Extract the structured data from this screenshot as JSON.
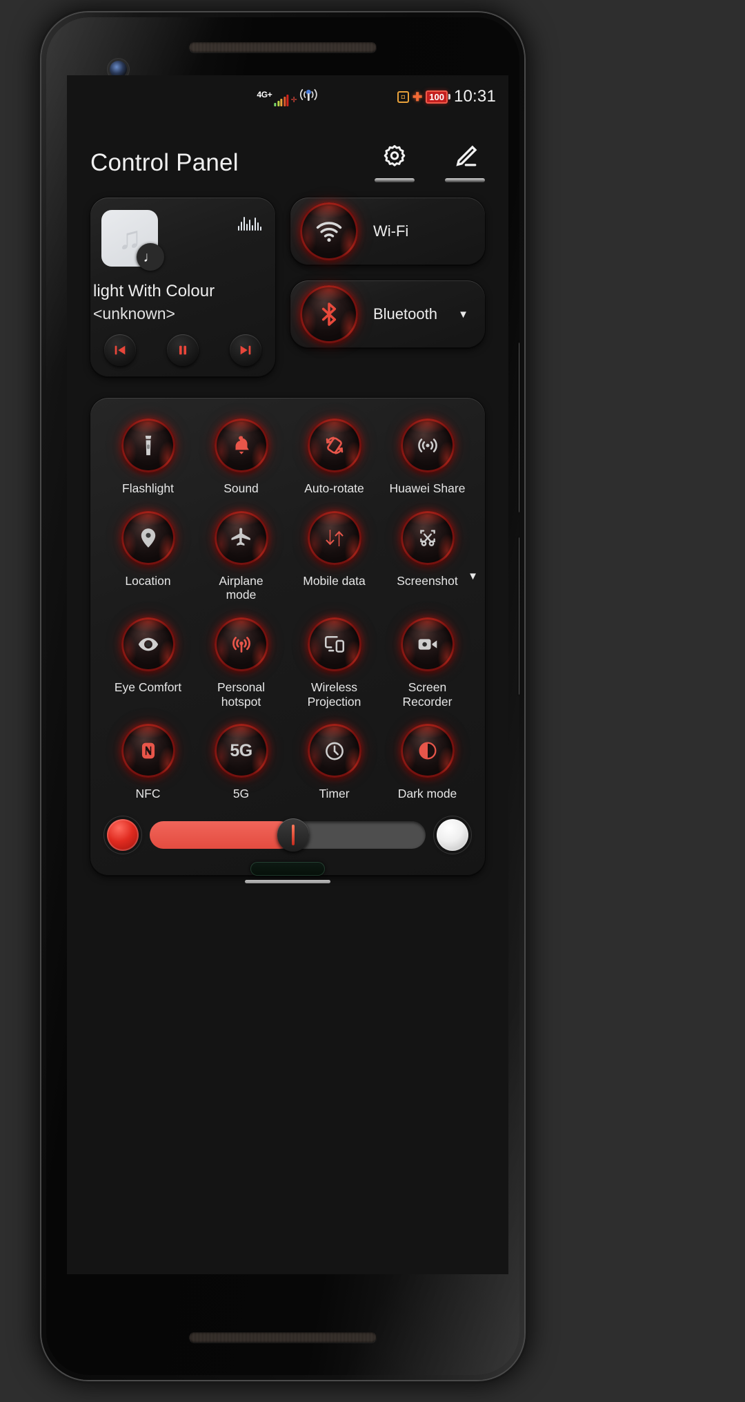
{
  "statusbar": {
    "network_label": "4G+",
    "signal_icon": "signal-bars-icon",
    "sim_cross_icon": "sim-cross-icon",
    "hotspot_icon": "hotspot-waves-icon",
    "nfc_icon": "nfc-square-icon",
    "bluetooth_icon": "bluetooth-icon",
    "battery_level": "100",
    "time": "10:31"
  },
  "header": {
    "title": "Control Panel",
    "settings_icon": "gear-icon",
    "edit_icon": "pencil-edit-icon"
  },
  "music": {
    "album_art_icon": "music-note-icon",
    "album_badge_icon": "single-note-icon",
    "equalizer_icon": "equalizer-icon",
    "title": "light With Colour",
    "artist": "<unknown>",
    "previous_icon": "skip-previous-icon",
    "play_pause_icon": "pause-icon",
    "next_icon": "skip-next-icon"
  },
  "connectivity": [
    {
      "label": "Wi-Fi",
      "icon": "wifi-icon",
      "caret": "",
      "has_caret": false
    },
    {
      "label": "Bluetooth",
      "icon": "bluetooth-icon",
      "caret": "▼",
      "has_caret": true
    }
  ],
  "tiles": [
    {
      "label": "Flashlight",
      "icon": "flashlight-icon",
      "has_caret": false
    },
    {
      "label": "Sound",
      "icon": "bell-icon",
      "has_caret": false
    },
    {
      "label": "Auto-rotate",
      "icon": "auto-rotate-icon",
      "has_caret": false
    },
    {
      "label": "Huawei Share",
      "icon": "huawei-share-icon",
      "has_caret": false
    },
    {
      "label": "Location",
      "icon": "location-pin-icon",
      "has_caret": false
    },
    {
      "label": "Airplane mode",
      "icon": "airplane-icon",
      "has_caret": false
    },
    {
      "label": "Mobile data",
      "icon": "mobile-data-arrows-icon",
      "has_caret": false
    },
    {
      "label": "Screenshot",
      "icon": "screenshot-scissors-icon",
      "has_caret": true,
      "caret": "▼"
    },
    {
      "label": "Eye Comfort",
      "icon": "eye-icon",
      "has_caret": false
    },
    {
      "label": "Personal hotspot",
      "icon": "hotspot-icon",
      "has_caret": false
    },
    {
      "label": "Wireless Projection",
      "icon": "cast-screen-icon",
      "has_caret": false
    },
    {
      "label": "Screen Recorder",
      "icon": "video-camera-icon",
      "has_caret": false
    },
    {
      "label": "NFC",
      "icon": "nfc-icon",
      "has_caret": false
    },
    {
      "label": "5G",
      "icon": "5g-text-icon",
      "has_caret": false
    },
    {
      "label": "Timer",
      "icon": "timer-clock-icon",
      "has_caret": false
    },
    {
      "label": "Dark mode",
      "icon": "dark-mode-contrast-icon",
      "has_caret": false
    }
  ],
  "brightness": {
    "min_icon": "brightness-low-icon",
    "max_icon": "brightness-high-icon",
    "value_percent": 52
  },
  "colors": {
    "accent_red": "#e44c40",
    "ember_ring": "#b8201a",
    "screen_bg": "#141414",
    "card_bg": "#1d1d1d",
    "text_primary": "#ededed",
    "battery_red": "#c41f1f"
  }
}
